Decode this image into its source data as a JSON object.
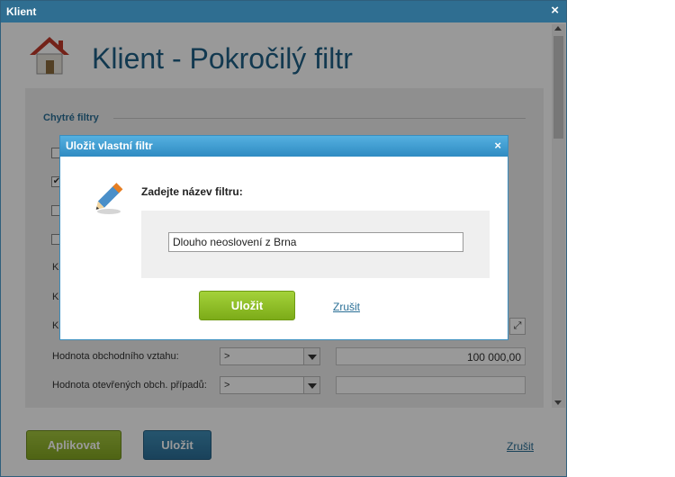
{
  "window": {
    "title": "Klient",
    "close_glyph": "×"
  },
  "page": {
    "title": "Klient - Pokročilý filtr",
    "icon": "home-icon"
  },
  "filters": {
    "section_title": "Chytré filtry",
    "checkbox_check_glyph": "✔",
    "stubs": [
      "Kl",
      "Kl",
      "Kl"
    ],
    "rows": [
      {
        "label": "Hodnota obchodního vztahu:",
        "operator": ">",
        "value": "100 000,00"
      },
      {
        "label": "Hodnota otevřených obch. případů:",
        "operator": ">",
        "value": ""
      }
    ],
    "expand_glyph": "⤢"
  },
  "footer": {
    "apply_label": "Aplikovat",
    "save_label": "Uložit",
    "cancel_label": "Zrušit"
  },
  "dialog": {
    "title": "Uložit vlastní filtr",
    "close_glyph": "×",
    "prompt": "Zadejte název filtru:",
    "input_value": "Dlouho neoslovení z Brna",
    "save_label": "Uložit",
    "cancel_label": "Zrušit",
    "icon": "pencil-icon"
  },
  "colors": {
    "brand_blue": "#2f6e91",
    "title_blue": "#1e5f86",
    "green": "#84a722",
    "dialog_blue": "#3a8dbd"
  }
}
